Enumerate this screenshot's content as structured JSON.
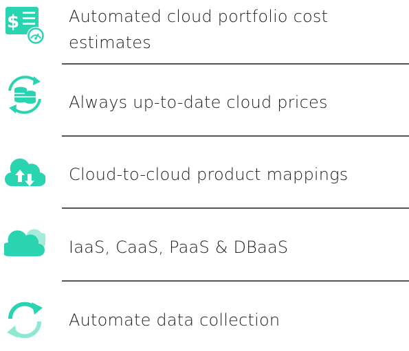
{
  "colors": {
    "accent": "#2ad4b0",
    "accent_light": "#8ee8d2",
    "text": "#1c1c1c",
    "divider": "#555555"
  },
  "features": [
    {
      "label": "Automated cloud portfolio cost estimates",
      "icon": "dollar-list-gauge-icon"
    },
    {
      "label": "Always up-to-date cloud prices",
      "icon": "database-refresh-icon"
    },
    {
      "label": "Cloud-to-cloud product mappings",
      "icon": "cloud-transfer-icon"
    },
    {
      "label": "IaaS, CaaS, PaaS & DBaaS",
      "icon": "cloud-stack-icon"
    },
    {
      "label": "Automate data collection",
      "icon": "sync-arrows-icon"
    }
  ]
}
